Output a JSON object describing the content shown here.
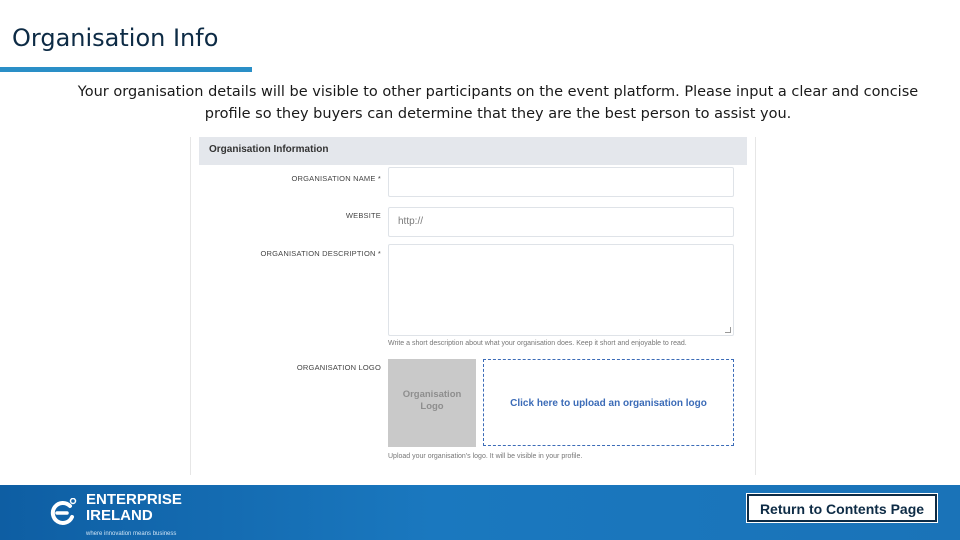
{
  "slide": {
    "title": "Organisation Info",
    "intro_line1": "Your organisation details will be visible to other participants on the event platform. Please input a clear and concise",
    "intro_line2": "profile so they buyers can determine that they are the best person to assist you."
  },
  "form": {
    "section_title": "Organisation Information",
    "fields": {
      "name": {
        "label": "ORGANISATION NAME *",
        "value": ""
      },
      "website": {
        "label": "WEBSITE",
        "placeholder": "http://"
      },
      "description": {
        "label": "ORGANISATION DESCRIPTION *",
        "value": "",
        "help": "Write a short description about what your organisation does. Keep it short and enjoyable to read."
      },
      "logo": {
        "label": "ORGANISATION LOGO",
        "placeholder_line1": "Organisation",
        "placeholder_line2": "Logo",
        "upload_label": "Click here to upload an organisation logo",
        "help": "Upload your organisation's logo. It will be visible in your profile."
      }
    }
  },
  "footer": {
    "brand_line1": "ENTERPRISE",
    "brand_line2": "IRELAND",
    "brand_tagline": "where innovation means business",
    "return_button": "Return to Contents Page",
    "colors": {
      "bar": "#1a73b8",
      "title": "#0d2b45",
      "accent_rule": "#2a8fc7"
    }
  }
}
